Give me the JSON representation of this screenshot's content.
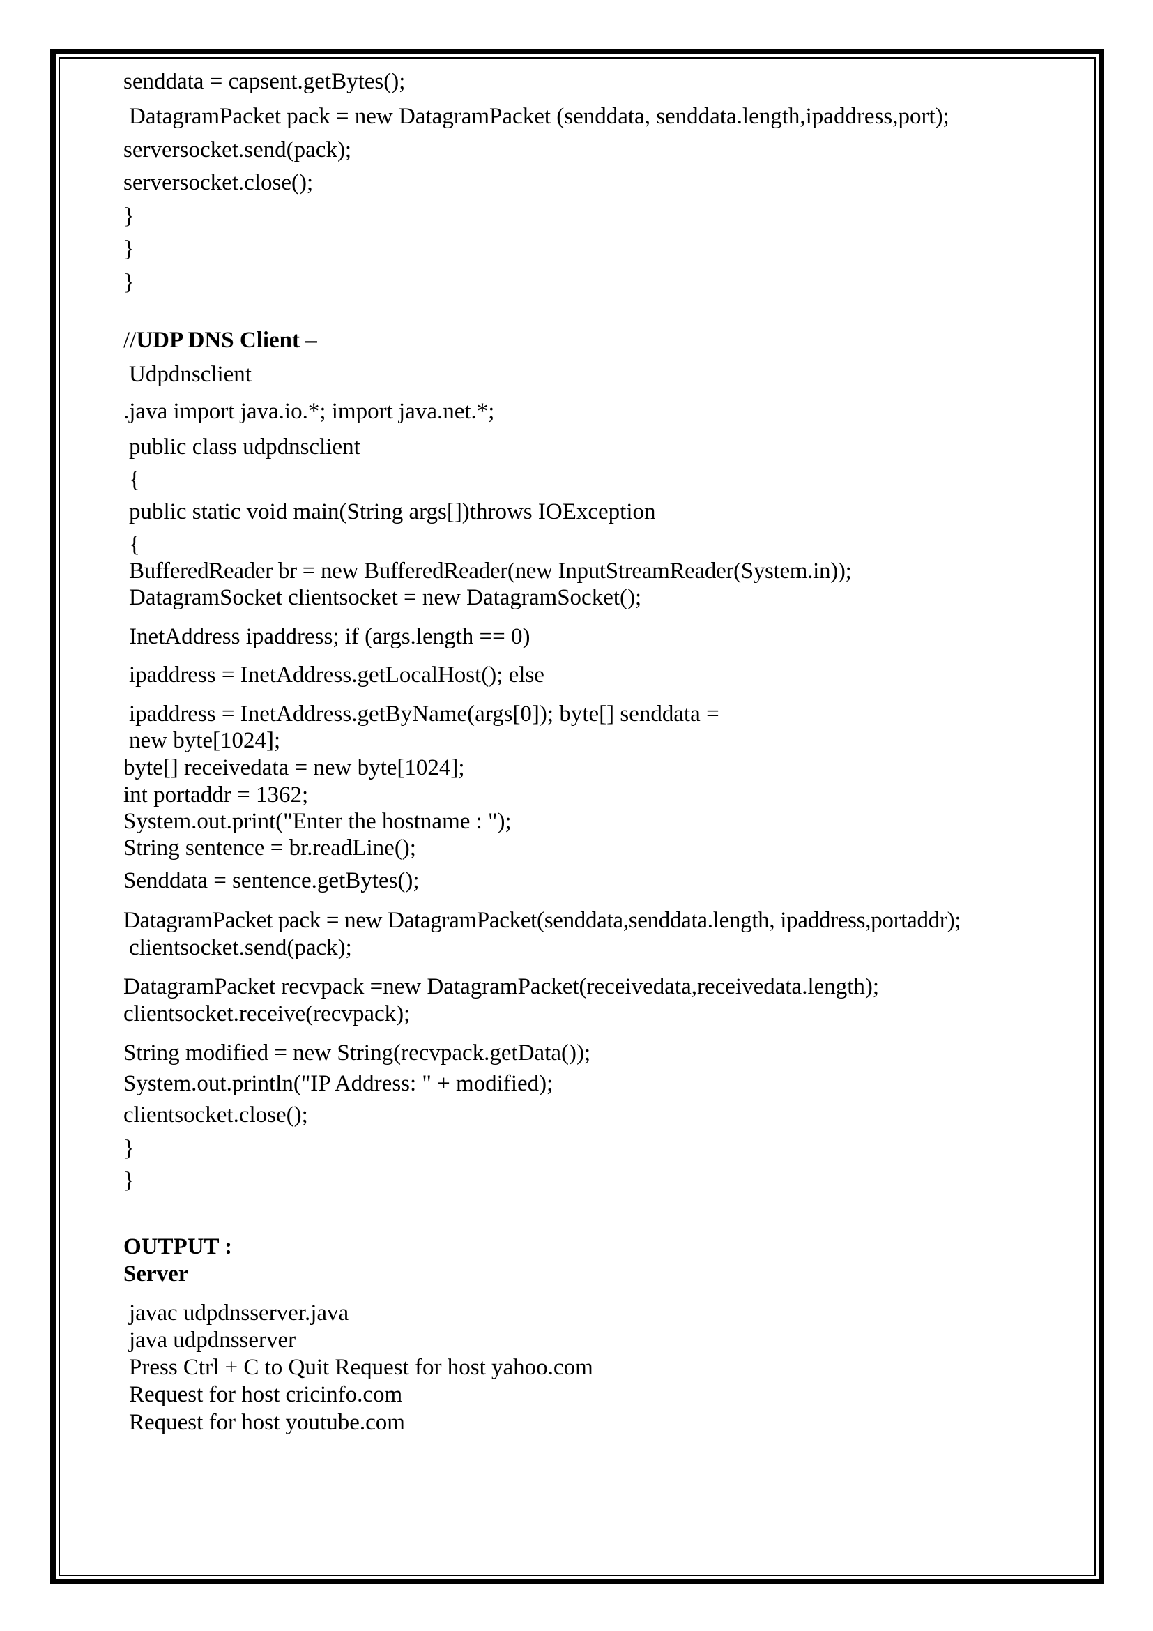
{
  "top_code": [
    "senddata = capsent.getBytes();",
    "DatagramPacket pack = new DatagramPacket (senddata, senddata.length,ipaddress,port);",
    "serversocket.send(pack);",
    "serversocket.close();",
    "}",
    "}",
    "}"
  ],
  "client_heading": {
    "prefix": "//",
    "title": "UDP DNS Client –"
  },
  "client_code": [
    "Udpdnsclient",
    ".java import java.io.*; import java.net.*;",
    "public class udpdnsclient",
    "{",
    "public static void main(String args[])throws IOException",
    "{",
    "BufferedReader br = new BufferedReader(new InputStreamReader(System.in));",
    "DatagramSocket clientsocket = new DatagramSocket();",
    "InetAddress ipaddress; if (args.length == 0)",
    "ipaddress = InetAddress.getLocalHost(); else",
    "ipaddress = InetAddress.getByName(args[0]); byte[] senddata =",
    "new byte[1024];",
    "byte[] receivedata = new byte[1024];",
    "int portaddr = 1362;",
    "System.out.print(\"Enter the hostname : \");",
    "String sentence = br.readLine();",
    "Senddata = sentence.getBytes();",
    "DatagramPacket pack = new DatagramPacket(senddata,senddata.length, ipaddress,portaddr);",
    "clientsocket.send(pack);",
    "DatagramPacket recvpack =new DatagramPacket(receivedata,receivedata.length);",
    "clientsocket.receive(recvpack);",
    "String modified = new String(recvpack.getData());",
    "System.out.println(\"IP Address: \" + modified);",
    "clientsocket.close();",
    "}",
    "}"
  ],
  "output_heading": "OUTPUT :",
  "server_heading": "Server",
  "output_lines": [
    "javac udpdnsserver.java",
    "java udpdnsserver",
    "Press Ctrl + C to Quit Request for host yahoo.com",
    "Request for host cricinfo.com",
    "Request for host youtube.com"
  ]
}
